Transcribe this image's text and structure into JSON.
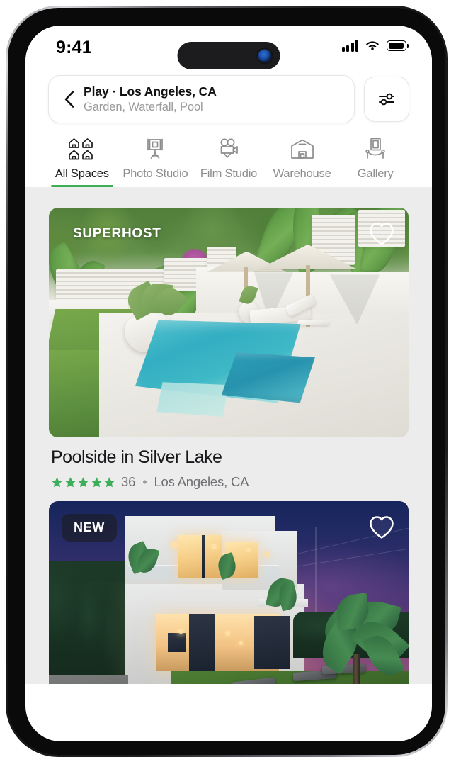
{
  "status_bar": {
    "time": "9:41",
    "signal_icon": "cellular-signal-icon",
    "wifi_icon": "wifi-icon",
    "battery_icon": "battery-full-icon"
  },
  "search": {
    "back_icon": "back-chevron-icon",
    "title": "Play · Los Angeles, CA",
    "subtitle": "Garden, Waterfall, Pool",
    "filter_icon": "filter-sliders-icon"
  },
  "tabs": [
    {
      "label": "All Spaces",
      "icon": "houses-grid-icon",
      "active": true
    },
    {
      "label": "Photo Studio",
      "icon": "photo-camera-tripod-icon",
      "active": false
    },
    {
      "label": "Film Studio",
      "icon": "film-camera-icon",
      "active": false
    },
    {
      "label": "Warehouse",
      "icon": "warehouse-icon",
      "active": false
    },
    {
      "label": "Gallery",
      "icon": "gallery-frame-icon",
      "active": false
    }
  ],
  "listings": [
    {
      "badge": "SUPERHOST",
      "badge_style": "plain",
      "favorite_icon": "heart-outline-icon",
      "title": "Poolside in Silver Lake",
      "rating_stars": 5,
      "review_count": "36",
      "separator": "•",
      "location": "Los Angeles, CA"
    },
    {
      "badge": "NEW",
      "badge_style": "pill",
      "favorite_icon": "heart-outline-icon",
      "title": "",
      "rating_stars": 0,
      "review_count": "",
      "separator": "",
      "location": ""
    }
  ],
  "colors": {
    "accent_green": "#3cae54",
    "star_green": "#3dae5a",
    "active_tab_text": "#1a1a1a",
    "inactive_tab_text": "#8d8d8d",
    "feed_background": "#ececed",
    "title_text": "#17171a",
    "meta_text": "#6f6f73"
  }
}
